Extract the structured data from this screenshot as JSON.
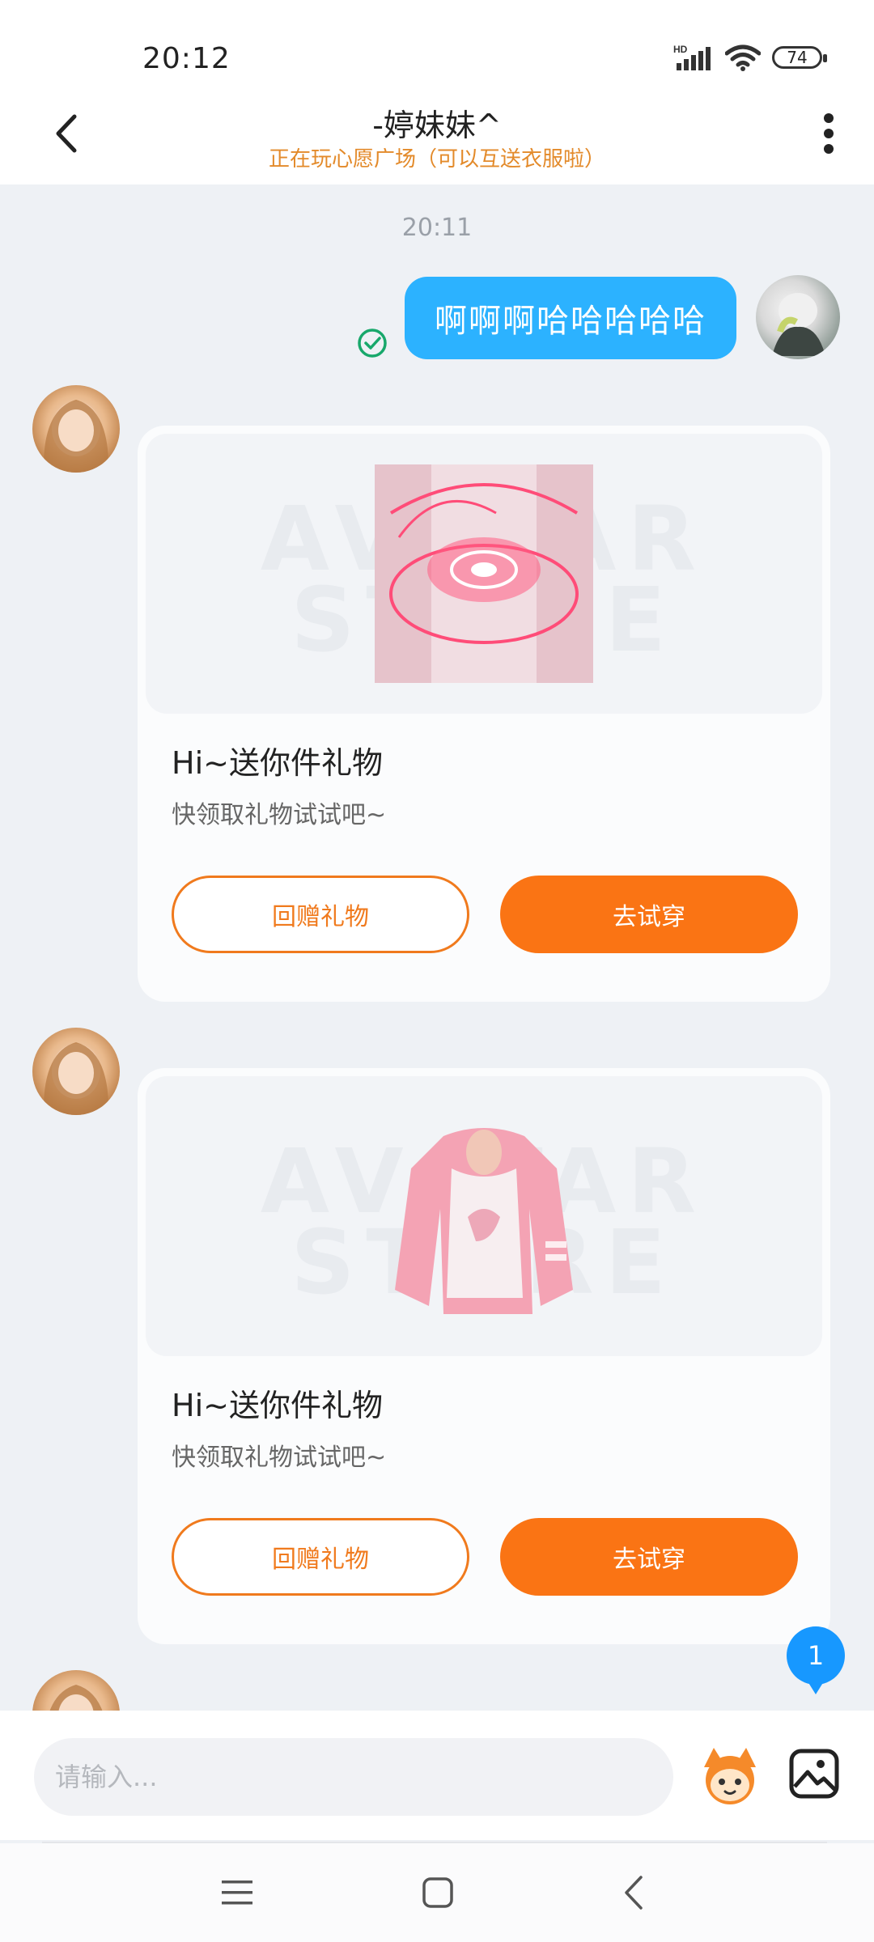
{
  "status_bar": {
    "time": "20:12",
    "network": "HD",
    "battery": "74"
  },
  "header": {
    "title": "-婷妹妹^",
    "subtitle": "正在玩心愿广场（可以互送衣服啦）"
  },
  "chat": {
    "time_separator": "20:11",
    "my_message": "啊啊啊哈哈哈哈哈",
    "gift_cards": [
      {
        "watermark": "AVATAR STORE",
        "title": "Hi~送你件礼物",
        "subtitle": "快领取礼物试试吧~",
        "return_gift_label": "回赠礼物",
        "try_on_label": "去试穿"
      },
      {
        "watermark": "AVATAR STORE",
        "title": "Hi~送你件礼物",
        "subtitle": "快领取礼物试试吧~",
        "return_gift_label": "回赠礼物",
        "try_on_label": "去试穿"
      }
    ],
    "unread_count": "1"
  },
  "input_bar": {
    "placeholder": "请输入..."
  },
  "colors": {
    "accent_orange": "#fa7414",
    "bubble_blue": "#2cb2ff",
    "subtitle_orange": "#e38a2a",
    "badge_blue": "#1798ff"
  }
}
